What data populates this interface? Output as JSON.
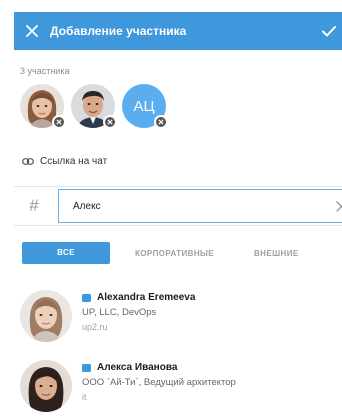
{
  "header": {
    "title": "Добавление участника",
    "close_icon": "close-icon",
    "confirm_icon": "check-icon",
    "color": "#3f97dc"
  },
  "participants": {
    "count_label": "3 участника",
    "items": [
      {
        "type": "photo",
        "photo": "woman-portrait",
        "badge_icon": "remove-icon"
      },
      {
        "type": "photo",
        "photo": "man-portrait",
        "badge_icon": "remove-icon"
      },
      {
        "type": "initials",
        "initials": "АЦ",
        "color": "#5aaef0",
        "badge_icon": "remove-icon"
      }
    ]
  },
  "chat_link": {
    "label": "Ссылка на чат",
    "icon": "link-icon"
  },
  "search": {
    "hash": "#",
    "value": "Алекс",
    "clear_icon": "clear-icon"
  },
  "tabs": [
    {
      "label": "ВСЕ",
      "active": true
    },
    {
      "label": "КОРПОРАТИВНЫЕ",
      "active": false
    },
    {
      "label": "ВНЕШНИЕ",
      "active": false
    }
  ],
  "results": [
    {
      "name": "Alexandra Eremeeva",
      "company": "UP, LLC, DevOps",
      "site": "up2.ru",
      "icon": "lock-icon"
    },
    {
      "name": "Алекса Иванова",
      "company": "ООО `Ай-Ти`, Ведущий архитектор",
      "site": "it",
      "icon": "lock-icon"
    }
  ]
}
